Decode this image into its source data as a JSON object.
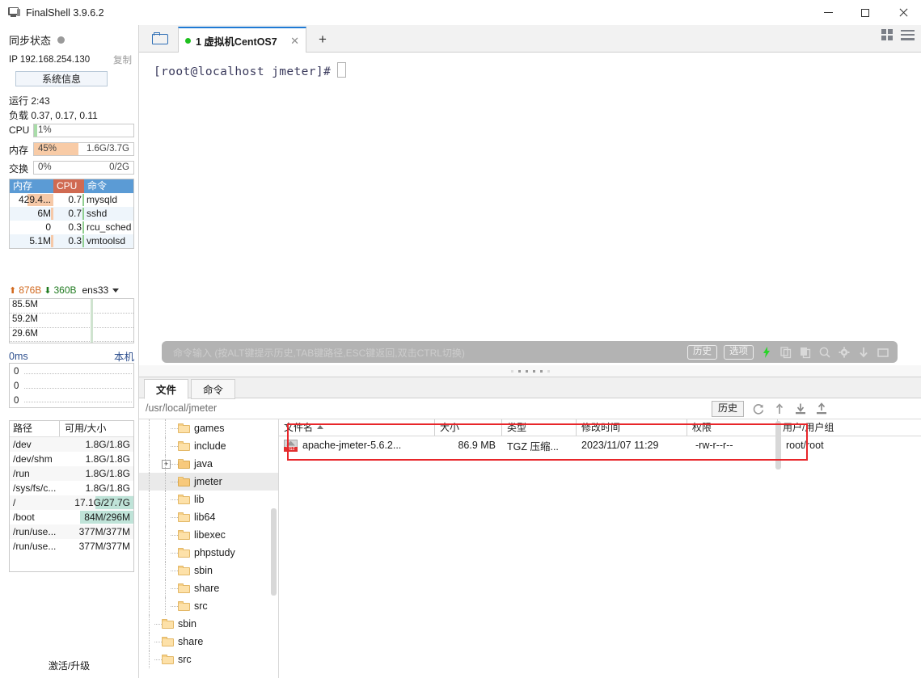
{
  "window": {
    "title": "FinalShell 3.9.6.2",
    "minimize": "—",
    "maximize": "□",
    "close": "✕"
  },
  "sidebar": {
    "sync_label": "同步状态",
    "ip_label": "IP 192.168.254.130",
    "copy_label": "复制",
    "sysinfo_button": "系统信息",
    "uptime": "运行 2:43",
    "load": "负载 0.37, 0.17, 0.11",
    "meters": [
      {
        "label": "CPU",
        "percent": "1%",
        "amount": "",
        "fill_pct": 3,
        "color": "#a9dca9"
      },
      {
        "label": "内存",
        "percent": "45%",
        "amount": "1.6G/3.7G",
        "fill_pct": 45,
        "color": "#f8cba6"
      },
      {
        "label": "交换",
        "percent": "0%",
        "amount": "0/2G",
        "fill_pct": 0,
        "color": "#f8cba6"
      }
    ],
    "process_headers": [
      "内存",
      "CPU",
      "命令"
    ],
    "processes": [
      {
        "mem": "429.4...",
        "cpu": "0.7",
        "cmd": "mysqld",
        "mem_bar": 22
      },
      {
        "mem": "6M",
        "cpu": "0.7",
        "cmd": "sshd",
        "mem_bar": 2
      },
      {
        "mem": "0",
        "cpu": "0.3",
        "cmd": "rcu_sched",
        "mem_bar": 0
      },
      {
        "mem": "5.1M",
        "cpu": "0.3",
        "cmd": "vmtoolsd",
        "mem_bar": 2
      }
    ],
    "net": {
      "upload": "876B",
      "download": "360B",
      "interface": "ens33",
      "scale_labels": [
        "85.5M",
        "59.2M",
        "29.6M"
      ]
    },
    "latency": {
      "value": "0ms",
      "target": "本机",
      "scale_labels": [
        "0",
        "0",
        "0"
      ]
    },
    "disk_headers": [
      "路径",
      "可用/大小"
    ],
    "disks": [
      {
        "path": "/dev",
        "size": "1.8G/1.8G",
        "hl": 0
      },
      {
        "path": "/dev/shm",
        "size": "1.8G/1.8G",
        "hl": 0
      },
      {
        "path": "/run",
        "size": "1.8G/1.8G",
        "hl": 0
      },
      {
        "path": "/sys/fs/c...",
        "size": "1.8G/1.8G",
        "hl": 0
      },
      {
        "path": "/",
        "size": "17.1G/27.7G",
        "hl": 52
      },
      {
        "path": "/boot",
        "size": "84M/296M",
        "hl": 72
      },
      {
        "path": "/run/use...",
        "size": "377M/377M",
        "hl": 0
      },
      {
        "path": "/run/use...",
        "size": "377M/377M",
        "hl": 0
      }
    ],
    "activate": "激活/升级"
  },
  "tabbar": {
    "folder_icon": "folder-open-icon",
    "tab_label": "1 虚拟机CentOS7",
    "tab_close": "✕",
    "add_tab": "+",
    "grid_icon": "grid-view-icon",
    "list_icon": "list-menu-icon"
  },
  "terminal": {
    "prompt": "[root@localhost jmeter]#"
  },
  "commandbar": {
    "placeholder": "命令输入 (按ALT键提示历史,TAB键路径,ESC键返回,双击CTRL切换)",
    "history_label": "历史",
    "options_label": "选项",
    "icons": [
      "lightning-icon",
      "copy-icon",
      "paste-icon",
      "search-icon",
      "gear-icon",
      "download-icon",
      "window-icon"
    ]
  },
  "filepanel": {
    "tabs": [
      {
        "label": "文件",
        "active": true
      },
      {
        "label": "命令",
        "active": false
      }
    ],
    "path": "/usr/local/jmeter",
    "history_label": "历史",
    "toolbar_icons": [
      "refresh-icon",
      "parent-dir-icon",
      "download-icon",
      "upload-icon"
    ],
    "tree": [
      {
        "label": "games",
        "indent": 2,
        "expander": false,
        "selected": false
      },
      {
        "label": "include",
        "indent": 2,
        "expander": false,
        "selected": false
      },
      {
        "label": "java",
        "indent": 2,
        "expander": true,
        "selected": false
      },
      {
        "label": "jmeter",
        "indent": 2,
        "expander": false,
        "selected": true
      },
      {
        "label": "lib",
        "indent": 2,
        "expander": false,
        "selected": false
      },
      {
        "label": "lib64",
        "indent": 2,
        "expander": false,
        "selected": false
      },
      {
        "label": "libexec",
        "indent": 2,
        "expander": false,
        "selected": false
      },
      {
        "label": "phpstudy",
        "indent": 2,
        "expander": false,
        "selected": false
      },
      {
        "label": "sbin",
        "indent": 2,
        "expander": false,
        "selected": false
      },
      {
        "label": "share",
        "indent": 2,
        "expander": false,
        "selected": false
      },
      {
        "label": "src",
        "indent": 2,
        "expander": false,
        "selected": false
      },
      {
        "label": "sbin",
        "indent": 1,
        "expander": false,
        "selected": false
      },
      {
        "label": "share",
        "indent": 1,
        "expander": false,
        "selected": false
      },
      {
        "label": "src",
        "indent": 1,
        "expander": false,
        "selected": false
      }
    ],
    "list_headers": [
      "文件名",
      "大小",
      "类型",
      "修改时间",
      "权限",
      "用户/用户组"
    ],
    "files": [
      {
        "name": "apache-jmeter-5.6.2...",
        "size": "86.9 MB",
        "type": "TGZ 压缩...",
        "modified": "2023/11/07 11:29",
        "perms": "-rw-r--r--",
        "owner": "root/root",
        "icon": "tgz-archive-icon"
      }
    ]
  },
  "colors": {
    "accent": "#1f7ad4",
    "tab_dot": "#1ec01e",
    "highlight_box": "#e8262a",
    "mem_bar": "#f8cba6",
    "cpu_bar": "#a9dca9"
  }
}
